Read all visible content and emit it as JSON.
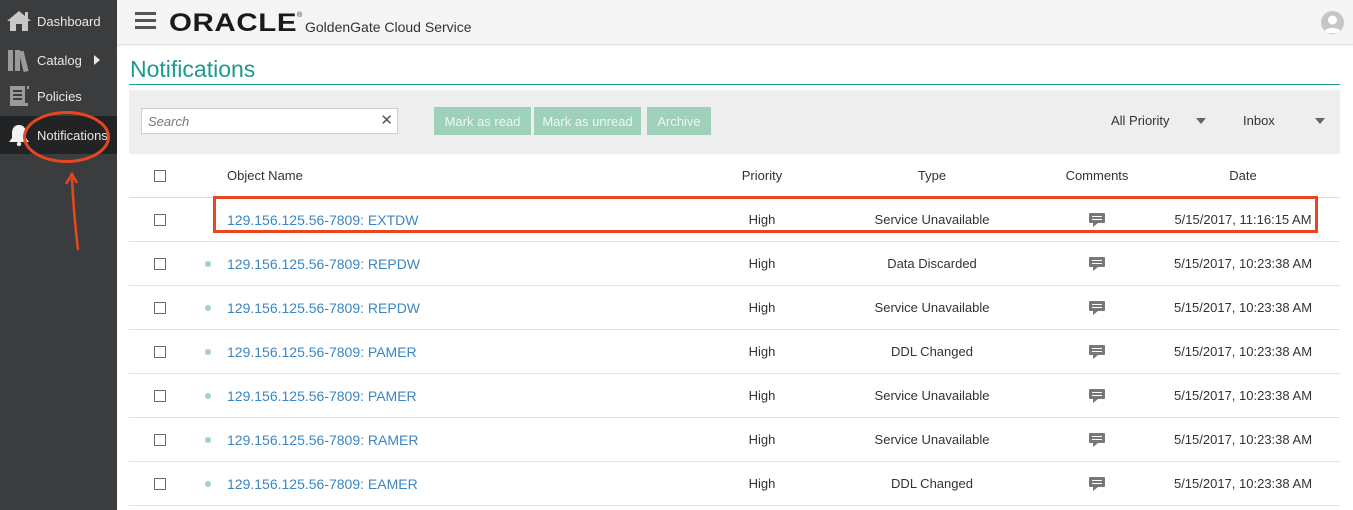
{
  "sidebar": {
    "items": [
      {
        "label": "Dashboard",
        "icon": "home-icon"
      },
      {
        "label": "Catalog",
        "icon": "books-icon"
      },
      {
        "label": "Policies",
        "icon": "policy-icon"
      },
      {
        "label": "Notifications",
        "icon": "bell-icon"
      }
    ]
  },
  "header": {
    "logo": "ORACLE",
    "logo_mark": "®",
    "service": "GoldenGate Cloud Service"
  },
  "page": {
    "title": "Notifications"
  },
  "toolbar": {
    "search_placeholder": "Search",
    "clear_glyph": "✕",
    "mark_read": "Mark as read",
    "mark_unread": "Mark as unread",
    "archive": "Archive",
    "priority_filter": "All Priority",
    "folder_filter": "Inbox"
  },
  "table": {
    "headers": {
      "object_name": "Object Name",
      "priority": "Priority",
      "type": "Type",
      "comments": "Comments",
      "date": "Date"
    },
    "rows": [
      {
        "name": "129.156.125.56-7809: EXTDW",
        "priority": "High",
        "type": "Service Unavailable",
        "date": "5/15/2017, 11:16:15 AM",
        "unread": false
      },
      {
        "name": "129.156.125.56-7809: REPDW",
        "priority": "High",
        "type": "Data Discarded",
        "date": "5/15/2017, 10:23:38 AM",
        "unread": true
      },
      {
        "name": "129.156.125.56-7809: REPDW",
        "priority": "High",
        "type": "Service Unavailable",
        "date": "5/15/2017, 10:23:38 AM",
        "unread": true
      },
      {
        "name": "129.156.125.56-7809: PAMER",
        "priority": "High",
        "type": "DDL Changed",
        "date": "5/15/2017, 10:23:38 AM",
        "unread": true
      },
      {
        "name": "129.156.125.56-7809: PAMER",
        "priority": "High",
        "type": "Service Unavailable",
        "date": "5/15/2017, 10:23:38 AM",
        "unread": true
      },
      {
        "name": "129.156.125.56-7809: RAMER",
        "priority": "High",
        "type": "Service Unavailable",
        "date": "5/15/2017, 10:23:38 AM",
        "unread": true
      },
      {
        "name": "129.156.125.56-7809: EAMER",
        "priority": "High",
        "type": "DDL Changed",
        "date": "5/15/2017, 10:23:38 AM",
        "unread": true
      }
    ]
  },
  "colors": {
    "accent": "#1d9a8f",
    "link": "#3b86c4",
    "button": "#9fd0b9",
    "annotation": "#e8461f",
    "sidebar": "#3a3c3e"
  }
}
